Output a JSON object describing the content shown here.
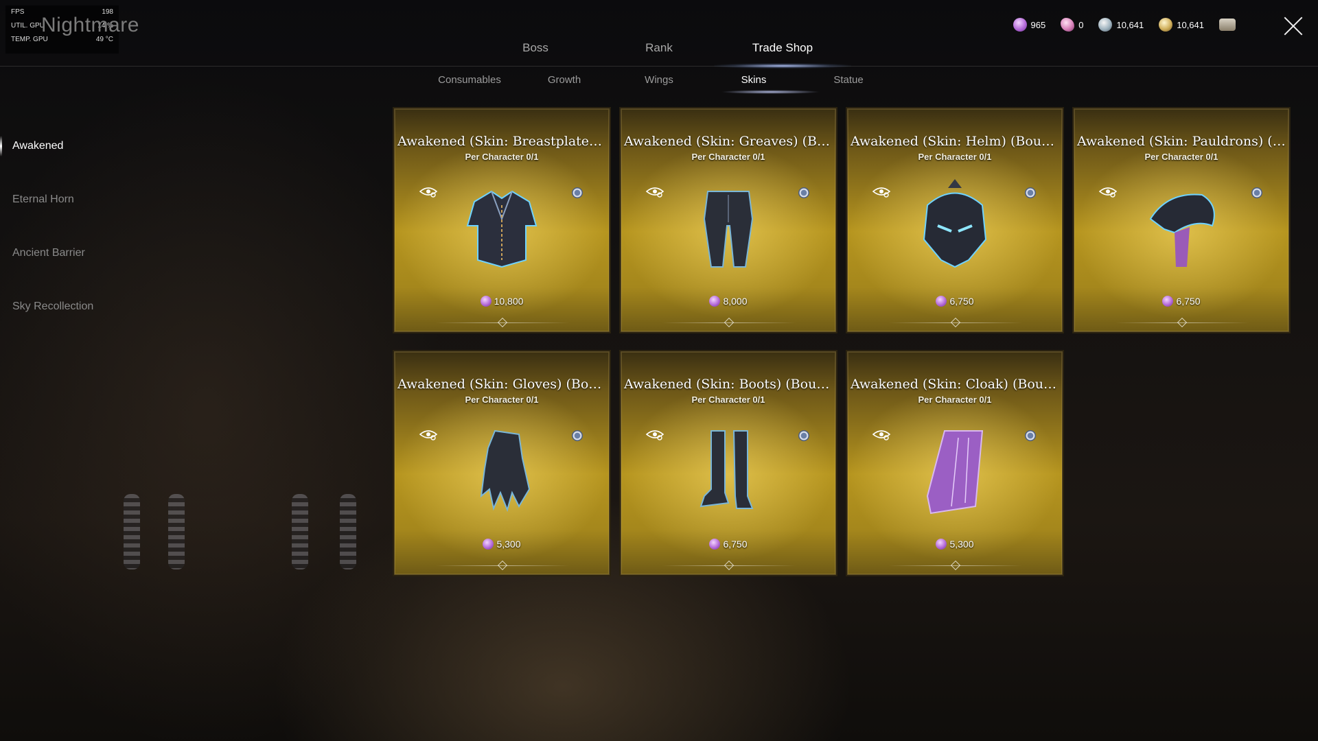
{
  "overlay": {
    "rows": [
      {
        "label": "FPS",
        "value": "198"
      },
      {
        "label": "UTIL. GPU",
        "value": "14 %"
      },
      {
        "label": "TEMP. GPU",
        "value": "49 °C"
      }
    ]
  },
  "window": {
    "title": "Nightmare"
  },
  "tabs": [
    {
      "label": "Boss",
      "active": false
    },
    {
      "label": "Rank",
      "active": false
    },
    {
      "label": "Trade Shop",
      "active": true
    }
  ],
  "subtabs": [
    {
      "label": "Consumables",
      "active": false
    },
    {
      "label": "Growth",
      "active": false
    },
    {
      "label": "Wings",
      "active": false
    },
    {
      "label": "Skins",
      "active": true
    },
    {
      "label": "Statue",
      "active": false
    }
  ],
  "currencies": [
    {
      "icon": "purple-gem-icon",
      "value": "965"
    },
    {
      "icon": "pink-feather-icon",
      "value": "0"
    },
    {
      "icon": "silver-coin-icon",
      "value": "10,641"
    },
    {
      "icon": "gold-coin-icon",
      "value": "10,641"
    }
  ],
  "sidebar": {
    "items": [
      {
        "label": "Awakened",
        "active": true
      },
      {
        "label": "Eternal Horn",
        "active": false
      },
      {
        "label": "Ancient Barrier",
        "active": false
      },
      {
        "label": "Sky Recollection",
        "active": false
      }
    ]
  },
  "cards": [
    {
      "title": "Awakened (Skin: Breastplate) (Bound)",
      "limit": "Per Character  0/1",
      "price": "10,800",
      "item": "breastplate"
    },
    {
      "title": "Awakened (Skin: Greaves) (Bound)",
      "limit": "Per Character  0/1",
      "price": "8,000",
      "item": "greaves"
    },
    {
      "title": "Awakened (Skin: Helm) (Bound)",
      "limit": "Per Character  0/1",
      "price": "6,750",
      "item": "helm"
    },
    {
      "title": "Awakened (Skin: Pauldrons) (Bound)",
      "limit": "Per Character  0/1",
      "price": "6,750",
      "item": "pauldrons"
    },
    {
      "title": "Awakened (Skin: Gloves) (Bound)",
      "limit": "Per Character  0/1",
      "price": "5,300",
      "item": "gloves"
    },
    {
      "title": "Awakened (Skin: Boots) (Bound)",
      "limit": "Per Character  0/1",
      "price": "6,750",
      "item": "boots"
    },
    {
      "title": "Awakened (Skin: Cloak) (Bound)",
      "limit": "Per Character  0/1",
      "price": "5,300",
      "item": "cloak"
    }
  ],
  "colors": {
    "card_gold": "#b6951f",
    "accent_purple": "#b46ad8",
    "active_text": "#ffffff",
    "inactive_text": "#8a8a8a"
  }
}
